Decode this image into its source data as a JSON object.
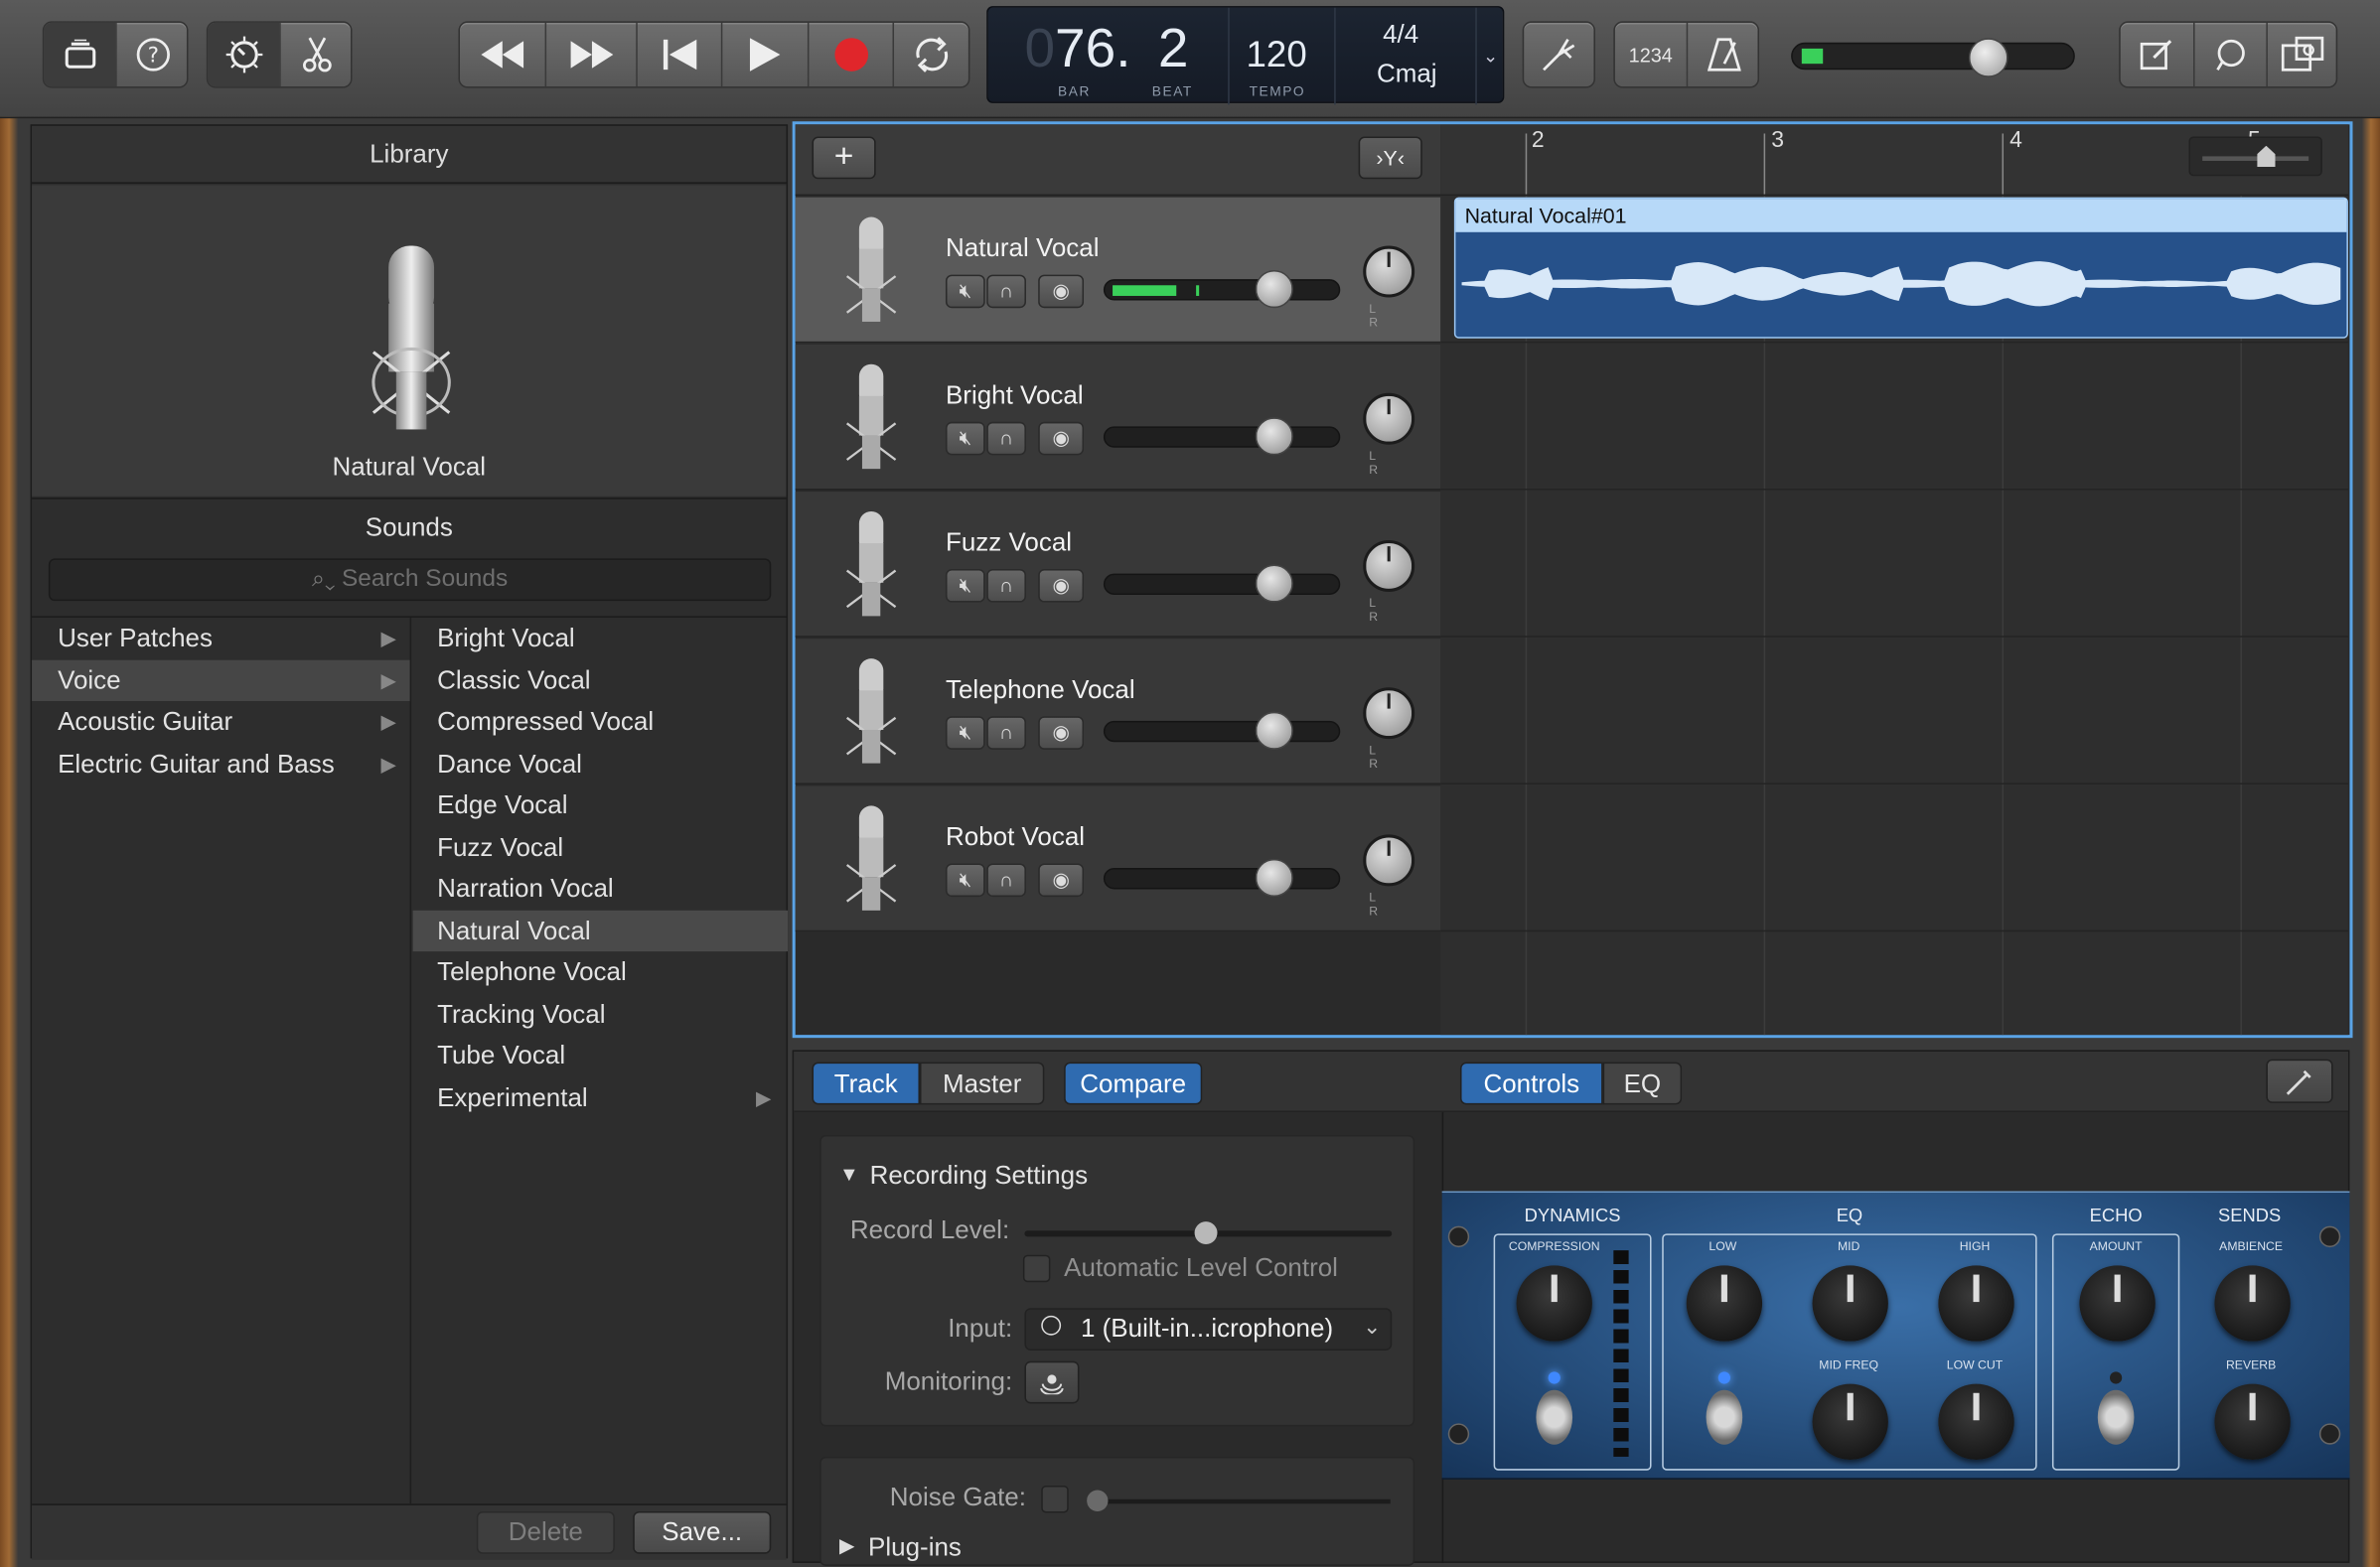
{
  "toolbar": {
    "lcd": {
      "bar_dim": "0",
      "bar": "76.",
      "beat": "2",
      "bar_label": "BAR",
      "beat_label": "BEAT",
      "tempo": "120",
      "tempo_label": "TEMPO",
      "signature": "4/4",
      "key": "Cmaj"
    },
    "count_in": "1234"
  },
  "library": {
    "title": "Library",
    "patch_name": "Natural Vocal",
    "sounds_title": "Sounds",
    "search_placeholder": "Search Sounds",
    "categories": [
      {
        "label": "User Patches"
      },
      {
        "label": "Voice"
      },
      {
        "label": "Acoustic Guitar"
      },
      {
        "label": "Electric Guitar and Bass"
      }
    ],
    "sounds": [
      "Bright Vocal",
      "Classic Vocal",
      "Compressed Vocal",
      "Dance Vocal",
      "Edge Vocal",
      "Fuzz Vocal",
      "Narration Vocal",
      "Natural Vocal",
      "Telephone Vocal",
      "Tracking Vocal",
      "Tube Vocal",
      "Experimental"
    ],
    "delete_label": "Delete",
    "save_label": "Save..."
  },
  "tracks": {
    "items": [
      {
        "name": "Natural Vocal"
      },
      {
        "name": "Bright Vocal"
      },
      {
        "name": "Fuzz Vocal"
      },
      {
        "name": "Telephone Vocal"
      },
      {
        "name": "Robot Vocal"
      }
    ],
    "region_name": "Natural Vocal#01",
    "ruler": [
      "2",
      "3",
      "4",
      "5"
    ],
    "pan_lr": "L R"
  },
  "bottom": {
    "tabs": {
      "track": "Track",
      "master": "Master",
      "compare": "Compare",
      "controls": "Controls",
      "eq": "EQ"
    },
    "recording_settings": "Recording Settings",
    "record_level": "Record Level:",
    "auto_level": "Automatic Level Control",
    "input_label": "Input:",
    "input_value": "1 (Built-in...icrophone)",
    "monitoring": "Monitoring:",
    "noise_gate": "Noise Gate:",
    "plugins": "Plug-ins"
  },
  "amp": {
    "dynamics": "DYNAMICS",
    "compression": "COMPRESSION",
    "eq": "EQ",
    "low": "LOW",
    "mid": "MID",
    "high": "HIGH",
    "mid_freq": "MID FREQ",
    "low_cut": "LOW CUT",
    "echo": "ECHO",
    "amount": "AMOUNT",
    "sends": "SENDS",
    "ambience": "AMBIENCE",
    "reverb": "REVERB"
  }
}
